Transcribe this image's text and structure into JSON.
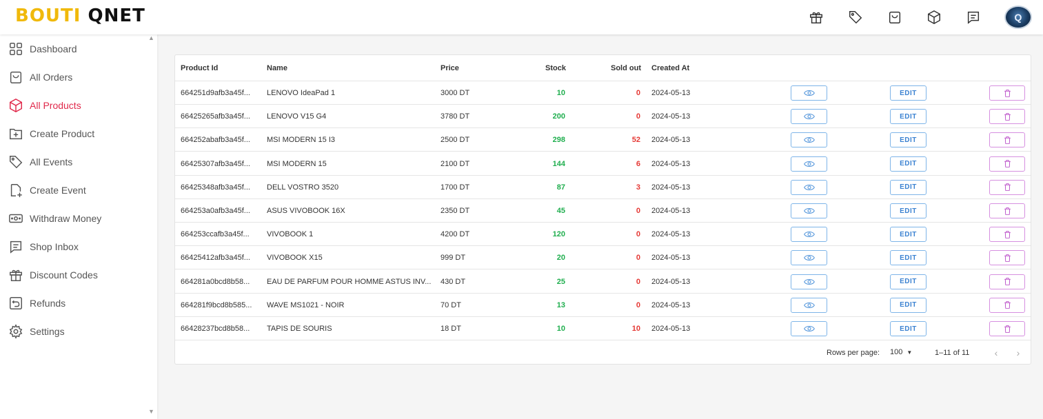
{
  "brand": {
    "part1": "BOUTI",
    "part2": "QNET"
  },
  "top_icons": [
    "gift-icon",
    "tag-icon",
    "shopping-bag-icon",
    "box-icon",
    "message-icon"
  ],
  "sidebar": {
    "items": [
      {
        "label": "Dashboard",
        "icon": "dashboard-icon"
      },
      {
        "label": "All Orders",
        "icon": "shopping-bag-icon"
      },
      {
        "label": "All Products",
        "icon": "box-icon",
        "active": true
      },
      {
        "label": "Create Product",
        "icon": "folder-plus-icon"
      },
      {
        "label": "All Events",
        "icon": "tag-icon"
      },
      {
        "label": "Create Event",
        "icon": "file-plus-icon"
      },
      {
        "label": "Withdraw Money",
        "icon": "cash-icon"
      },
      {
        "label": "Shop Inbox",
        "icon": "message-icon"
      },
      {
        "label": "Discount Codes",
        "icon": "gift-icon"
      },
      {
        "label": "Refunds",
        "icon": "refund-icon"
      },
      {
        "label": "Settings",
        "icon": "gear-icon"
      }
    ]
  },
  "table": {
    "headers": {
      "product_id": "Product Id",
      "name": "Name",
      "price": "Price",
      "stock": "Stock",
      "sold_out": "Sold out",
      "created_at": "Created At"
    },
    "edit_label": "EDIT",
    "rows": [
      {
        "id": "664251d9afb3a45f...",
        "name": "LENOVO IdeaPad 1",
        "price": "3000 DT",
        "stock": "10",
        "sold": "0",
        "created": "2024-05-13"
      },
      {
        "id": "66425265afb3a45f...",
        "name": "LENOVO V15 G4",
        "price": "3780 DT",
        "stock": "200",
        "sold": "0",
        "created": "2024-05-13"
      },
      {
        "id": "664252abafb3a45f...",
        "name": "MSI MODERN 15 I3",
        "price": "2500 DT",
        "stock": "298",
        "sold": "52",
        "created": "2024-05-13"
      },
      {
        "id": "66425307afb3a45f...",
        "name": "MSI MODERN 15",
        "price": "2100 DT",
        "stock": "144",
        "sold": "6",
        "created": "2024-05-13"
      },
      {
        "id": "66425348afb3a45f...",
        "name": "DELL VOSTRO 3520",
        "price": "1700 DT",
        "stock": "87",
        "sold": "3",
        "created": "2024-05-13"
      },
      {
        "id": "664253a0afb3a45f...",
        "name": "ASUS VIVOBOOK 16X",
        "price": "2350 DT",
        "stock": "45",
        "sold": "0",
        "created": "2024-05-13"
      },
      {
        "id": "664253ccafb3a45f...",
        "name": "VIVOBOOK 1",
        "price": "4200 DT",
        "stock": "120",
        "sold": "0",
        "created": "2024-05-13"
      },
      {
        "id": "66425412afb3a45f...",
        "name": "VIVOBOOK X15",
        "price": "999 DT",
        "stock": "20",
        "sold": "0",
        "created": "2024-05-13"
      },
      {
        "id": "664281a0bcd8b58...",
        "name": "EAU DE PARFUM POUR HOMME ASTUS INV...",
        "price": "430 DT",
        "stock": "25",
        "sold": "0",
        "created": "2024-05-13"
      },
      {
        "id": "664281f9bcd8b585...",
        "name": "WAVE MS1021 - NOIR",
        "price": "70 DT",
        "stock": "13",
        "sold": "0",
        "created": "2024-05-13"
      },
      {
        "id": "66428237bcd8b58...",
        "name": "TAPIS DE SOURIS",
        "price": "18 DT",
        "stock": "10",
        "sold": "10",
        "created": "2024-05-13"
      }
    ]
  },
  "pagination": {
    "rows_per_page_label": "Rows per page:",
    "rows_per_page_value": "100",
    "range": "1–11 of 11"
  }
}
